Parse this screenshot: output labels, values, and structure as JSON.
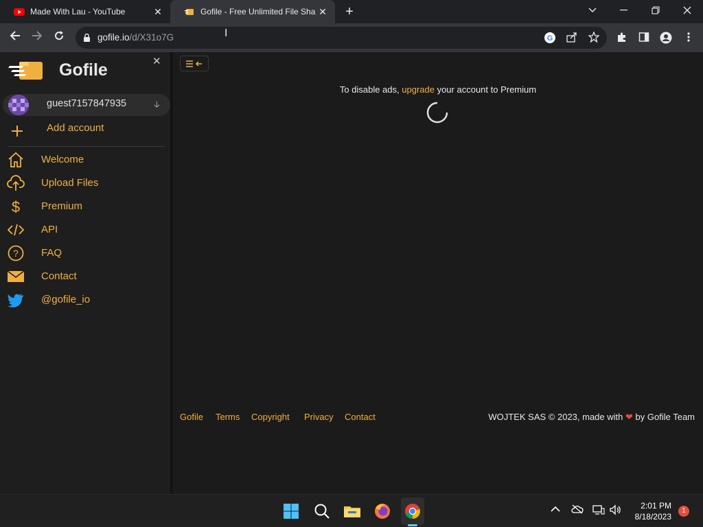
{
  "browser": {
    "tabs": [
      {
        "title": "Made With Lau - YouTube",
        "active": false,
        "favicon": "youtube-icon"
      },
      {
        "title": "Gofile - Free Unlimited File Sharing",
        "active": true,
        "favicon": "gofile-icon"
      }
    ],
    "url_host": "gofile.io",
    "url_path": "/d/X31o7G"
  },
  "sidebar": {
    "brand": "Gofile",
    "account": {
      "name": "guest7157847935"
    },
    "add_account": "Add account",
    "items": [
      {
        "label": "Welcome",
        "icon": "home-icon"
      },
      {
        "label": "Upload Files",
        "icon": "cloud-upload-icon"
      },
      {
        "label": "Premium",
        "icon": "dollar-icon"
      },
      {
        "label": "API",
        "icon": "code-icon"
      },
      {
        "label": "FAQ",
        "icon": "question-icon"
      },
      {
        "label": "Contact",
        "icon": "envelope-icon"
      },
      {
        "label": "@gofile_io",
        "icon": "twitter-icon"
      }
    ]
  },
  "main": {
    "ads_prefix": "To disable ads, ",
    "ads_link": "upgrade",
    "ads_suffix": " your account to Premium"
  },
  "footer": {
    "links": [
      "Gofile",
      "Terms",
      "Copyright",
      "Privacy",
      "Contact"
    ],
    "credit_prefix": "WOJTEK SAS © 2023, made with",
    "credit_suffix": "by Gofile Team"
  },
  "taskbar": {
    "time": "2:01 PM",
    "date": "8/18/2023",
    "notifications": "1"
  },
  "colors": {
    "accent": "#f0b040",
    "page_bg": "#1b1b1c",
    "sidebar_bg": "#1e1e1f",
    "chrome_bg": "#35363a"
  }
}
